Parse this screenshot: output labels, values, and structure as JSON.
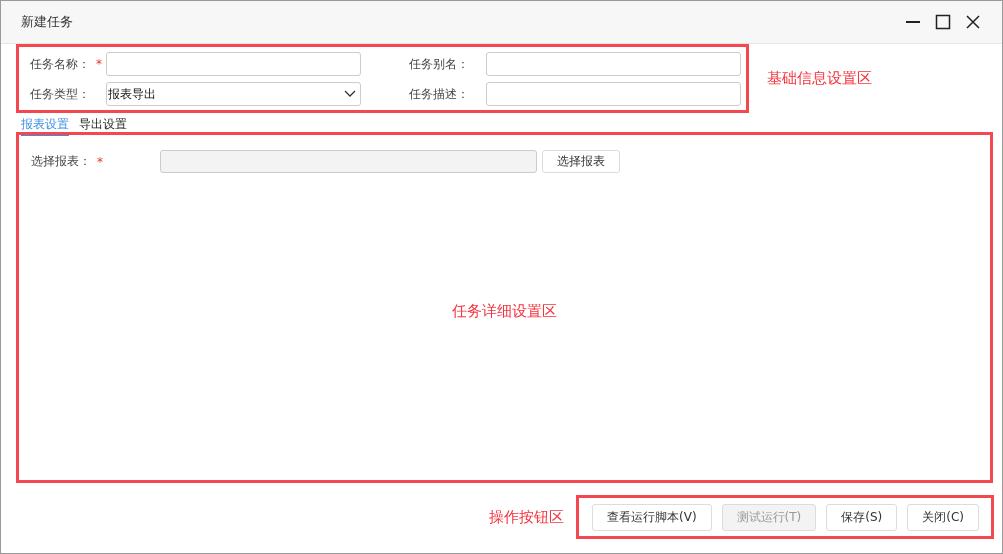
{
  "window": {
    "title": "新建任务"
  },
  "basic_info": {
    "annotation": "基础信息设置区",
    "fields": [
      {
        "label": "任务名称：",
        "required_mark": "*",
        "kind": "text"
      },
      {
        "label": "任务别名：",
        "kind": "text"
      },
      {
        "label": "任务类型：",
        "kind": "select",
        "value": "报表导出"
      },
      {
        "label": "任务描述：",
        "kind": "text"
      }
    ]
  },
  "tabs": [
    {
      "label": "报表设置",
      "selected": true
    },
    {
      "label": "导出设置",
      "selected": false
    }
  ],
  "detail": {
    "annotation": "任务详细设置区",
    "field": {
      "label": "选择报表：",
      "required_mark": "*",
      "disabled": true,
      "button": "选择报表"
    }
  },
  "actions": {
    "annotation": "操作按钮区",
    "buttons": [
      {
        "label": "查看运行脚本(V)",
        "disabled": false
      },
      {
        "label": "测试运行(T)",
        "disabled": true
      },
      {
        "label": "保存(S)",
        "disabled": false
      },
      {
        "label": "关闭(C)",
        "disabled": false
      }
    ]
  }
}
